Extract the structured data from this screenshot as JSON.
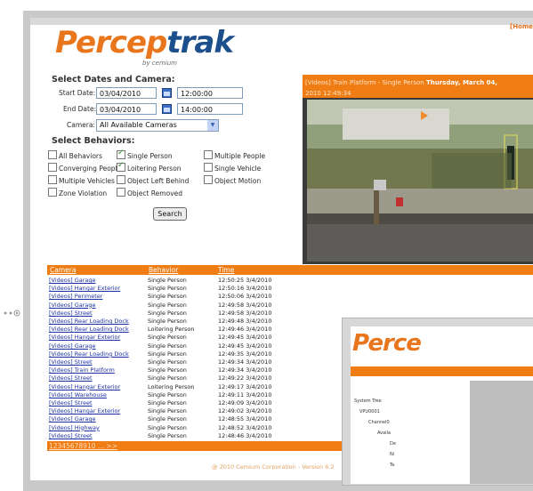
{
  "header": {
    "home_link": "[Home"
  },
  "logo": {
    "part1": "Percep",
    "part2": "trak",
    "byline": "by cemium"
  },
  "search": {
    "section_title": "Select Dates and Camera:",
    "start_date_label": "Start Date:",
    "start_date": "03/04/2010",
    "start_time": "12:00:00",
    "end_date_label": "End Date:",
    "end_date": "03/04/2010",
    "end_time": "14:00:00",
    "camera_label": "Camera:",
    "camera_value": "All Available Cameras",
    "behaviors_title": "Select Behaviors:",
    "behaviors": [
      {
        "label": "All Behaviors",
        "checked": false
      },
      {
        "label": "Single Person",
        "checked": true
      },
      {
        "label": "Multiple People",
        "checked": false
      },
      {
        "label": "Converging People",
        "checked": false
      },
      {
        "label": "Loitering Person",
        "checked": true
      },
      {
        "label": "Single Vehicle",
        "checked": false
      },
      {
        "label": "Multiple Vehicles",
        "checked": false
      },
      {
        "label": "Object Left Behind",
        "checked": false
      },
      {
        "label": "Object Motion",
        "checked": false
      },
      {
        "label": "Zone Violation",
        "checked": false
      },
      {
        "label": "Object Removed",
        "checked": false
      }
    ],
    "search_button": "Search"
  },
  "video": {
    "title": "[Videos] Train Platform - Single Person",
    "date_bold": "Thursday, March 04,",
    "time": "2010 12:49:34"
  },
  "results": {
    "columns": [
      "Camera",
      "Behavior",
      "Time"
    ],
    "rows": [
      [
        "[Videos] Garage",
        "Single Person",
        "12:50:25 3/4/2010"
      ],
      [
        "[Videos] Hangar Exterior",
        "Single Person",
        "12:50:16 3/4/2010"
      ],
      [
        "[Videos] Perimeter",
        "Single Person",
        "12:50:06 3/4/2010"
      ],
      [
        "[Videos] Garage",
        "Single Person",
        "12:49:58 3/4/2010"
      ],
      [
        "[Videos] Street",
        "Single Person",
        "12:49:58 3/4/2010"
      ],
      [
        "[Videos] Rear Loading Dock",
        "Single Person",
        "12:49:48 3/4/2010"
      ],
      [
        "[Videos] Rear Loading Dock",
        "Loitering Person",
        "12:49:46 3/4/2010"
      ],
      [
        "[Videos] Hangar Exterior",
        "Single Person",
        "12:49:45 3/4/2010"
      ],
      [
        "[Videos] Garage",
        "Single Person",
        "12:49:45 3/4/2010"
      ],
      [
        "[Videos] Rear Loading Dock",
        "Single Person",
        "12:49:35 3/4/2010"
      ],
      [
        "[Videos] Street",
        "Single Person",
        "12:49:34 3/4/2010"
      ],
      [
        "[Videos] Train Platform",
        "Single Person",
        "12:49:34 3/4/2010"
      ],
      [
        "[Videos] Street",
        "Single Person",
        "12:49:22 3/4/2010"
      ],
      [
        "[Videos] Hangar Exterior",
        "Loitering Person",
        "12:49:17 3/4/2010"
      ],
      [
        "[Videos] Warehouse",
        "Single Person",
        "12:49:11 3/4/2010"
      ],
      [
        "[Videos] Street",
        "Single Person",
        "12:49:09 3/4/2010"
      ],
      [
        "[Videos] Hangar Exterior",
        "Single Person",
        "12:49:02 3/4/2010"
      ],
      [
        "[Videos] Garage",
        "Single Person",
        "12:48:55 3/4/2010"
      ],
      [
        "[Videos] Highway",
        "Single Person",
        "12:48:52 3/4/2010"
      ],
      [
        "[Videos] Street",
        "Single Person",
        "12:48:46 3/4/2010"
      ]
    ],
    "pager": "12345678910 ... >>"
  },
  "footer": {
    "copyright": "@ 2010 Cemium Corporation - Version 6.2"
  },
  "inset": {
    "logo": "Perce",
    "tree": [
      "System Tree",
      "VPU0001",
      "Channel0",
      "Availa",
      "De",
      "Ni",
      "Te"
    ]
  },
  "colors": {
    "accent": "#f07c14",
    "brand_blue": "#1d4f8c",
    "link": "#1a2fa0"
  }
}
